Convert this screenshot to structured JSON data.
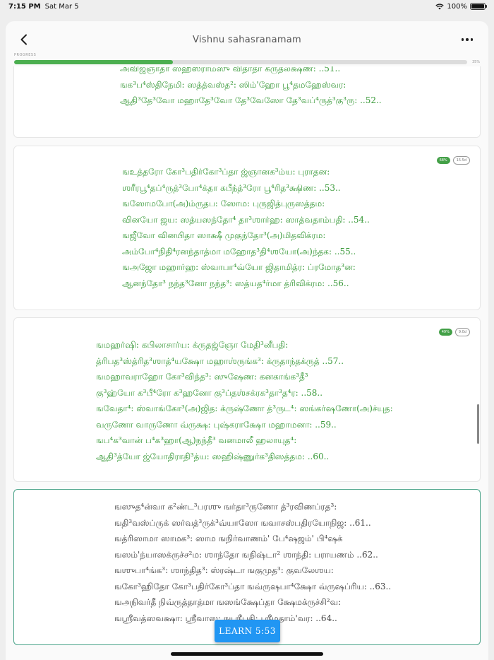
{
  "status_bar": {
    "time": "7:15 PM",
    "date": "Sat Mar 5",
    "battery": "100%"
  },
  "nav": {
    "title": "Vishnu sahasranamam"
  },
  "progress": {
    "label": "PROGRESS",
    "percent_text": "35%",
    "value": 0.35
  },
  "cards": [
    {
      "lines": [
        "அவிஜ்ஞாதா ஸஹஸ்ராம்ஸு விதாதா க்ருதலக்ஷண: ..51..",
        "ஙக³ப⁴ஸ்திநேமி: ஸத்த்வஸ்த²: ஸிம்'ஹோ பூ⁴தமஹேஸ்வர:",
        "ஆதி³தே³வோ மஹாதே³வோ தே³வேஸோ தே³வப்⁴ருத்³கு³ரு: ..52.."
      ]
    },
    {
      "badge_pct": "68%",
      "badge_days": "15.5d",
      "lines": [
        "ஙஉத்தரோ கோ³பதிர்கோ³ப்தா ஜ்ஞானக³ம்ய: புராதன:",
        "ஶரீரபூ⁴தப்⁴ருத்³போ⁴க்தா கபீந்த்³ரோ பூ⁴ரித³க்ஷிண: ..53..",
        "ஙஸோமபோ(அ)ம்ருதப: ஸோம: புருஜித்புருஸத்தம:",
        "வினயோ ஜய: ஸத்யஸந்தோ⁴ தா³ஶார்ஹ: ஸாத்வதாம்பதி: ..54..",
        "ஙஜீவோ வினயிதா ஸாக்ஷீ முகுந்தோ³(அ)மிதவிக்ரம:",
        "அம்போ⁴நிதி⁴ரனந்தாத்மா மஹோத³தி⁴ஶயோ(அ)ந்தக: ..55..",
        "ஙஅஜோ மஹார்ஹ: ஸ்வாபா⁴வ்யோ ஜிதாமித்ர: ப்ரமோத³ன:",
        "ஆனந்தோ³ நந்த³னோ நந்த³: ஸத்யத⁴ர்மா த்ரிவிக்ரம: ..56.."
      ]
    },
    {
      "badge_pct": "49%",
      "badge_days": "9.0d",
      "lines": [
        "ஙமஹர்ஷி: கபிலாசார்ய: க்ருதஜ்ஞோ மேதி³னீபதி:",
        "த்ரிபத³ஸ்த்ரித³ஶாத்⁴யக்ஷோ மஹாஶ்ருங்க³: க்ருதாந்தக்ருத் ..57..",
        "ஙமஹாவராஹோ கோ³விந்த³: ஸுஷேண: கனகாங்க³தீ³",
        "கு³ஹ்யோ க³பீ⁴ரோ க³ஹனோ கு³ப்தஶ்சக்ரக³தா³த⁴ர: ..58..",
        "ஙவேதா⁴: ஸ்வாங்கோ³(அ)ஜித: க்ருஷ்ணோ த்³ருட⁴: ஸங்கர்ஷணோ(அ)ச்யுத:",
        "வருணோ வாருணோ வ்ருக்ஷ: புஷ்கராக்ஷோ மஹாமனா: ..59..",
        "ஙப⁴க³வான் ப⁴க³ஹா(ஆ)நந்தீ³ வனமாலீ ஹலாயுத⁴:",
        "ஆதி³த்யோ ஜ்யோதிராதி³த்ய: ஸஹிஷ்ணுர்க³திஸத்தம: ..60.."
      ]
    },
    {
      "lines": [
        "ஙஸுத⁴ன்வா க²ண்ட³பரஶு ஙர்தா³ருணோ த்³ரவிணப்ரத³:",
        "ஙதி³வஸ்ப்ருக் ஸர்வத்³ருக்³வ்யாஸோ ஙவாசஸ்பதிரயோநிஜ: ..61..",
        "ஙத்ரிஸாமா ஸாமக³: ஸாம ஙநிர்வாணம்' பே⁴ஷஜம்' பி⁴ஷக்",
        "ஙஸம்'ந்யாஸக்ருச்ச²ம: ஶாந்தோ ஙநிஷ்டா² ஶாந்தி: பராயணம் ..62..",
        "ஙஶுபா⁴ங்க³: ஶாந்தித³: ஸ்ரஷ்டா ஙகுமுத³: குவலேஶய:",
        "ஙகோ³ஹிதோ கோ³பதிர்கோ³ப்தா ஙவ்ருஷபா⁴க்ஷோ வ்ருஷப்ரிய: ..63..",
        "ஙஅநிவர்தீ நிவ்ருத்தாத்மா ஙஸங்க்ஷேப்தா க்ஷேமக்ருச்சி²வ:",
        "ஙஶ்ரீவத்ஸவக்ஷா: ஶ்ரீவாஸ: ஙஶ்ரீபதி: ஶ்ரீமதாம்'வர: ..64.."
      ]
    }
  ],
  "learn_button": {
    "label": "LEARN 5:53"
  },
  "colors": {
    "progress_fill": "#4caf50",
    "verse_green": "#3a9a3a",
    "active_border": "#4aa389",
    "learn_button": "#2196f3"
  }
}
